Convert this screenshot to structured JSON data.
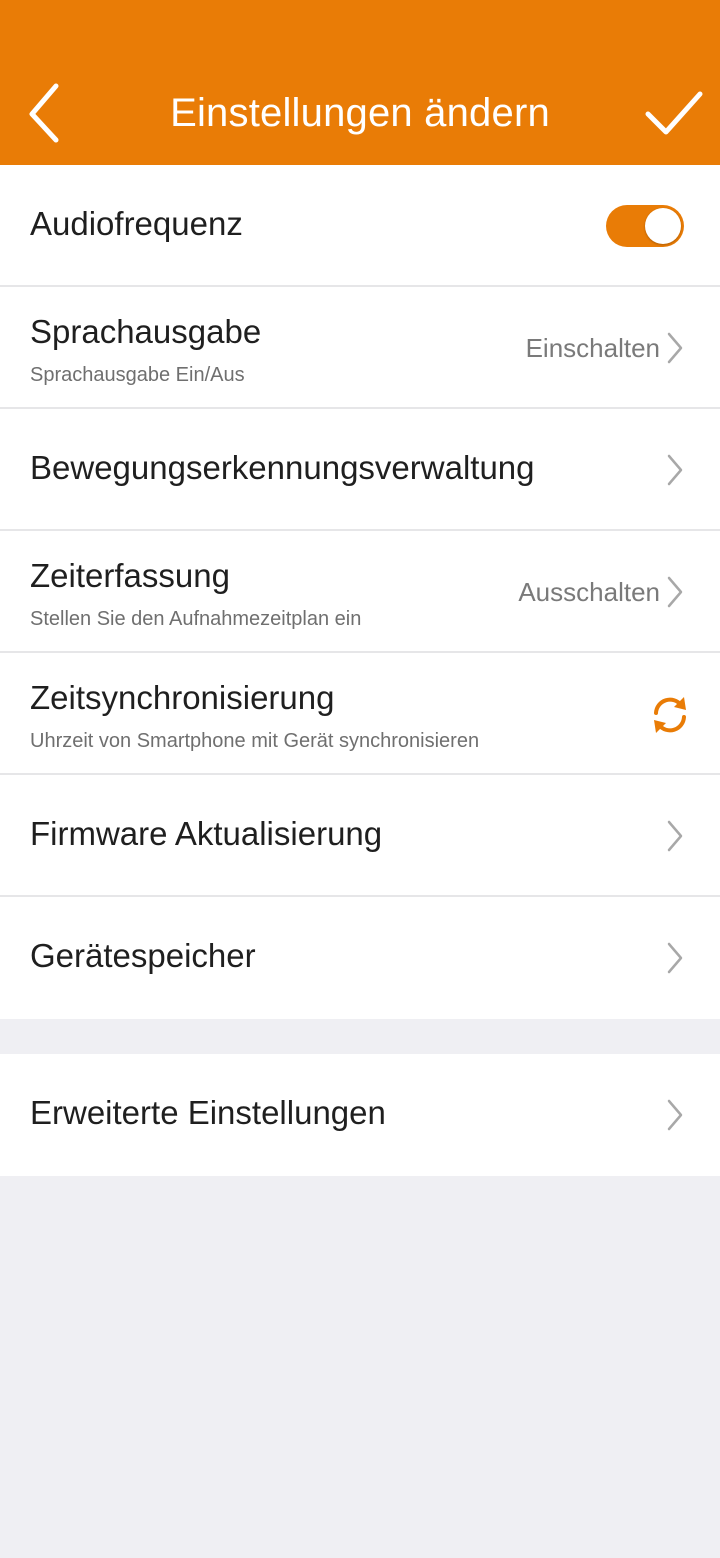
{
  "header": {
    "title": "Einstellungen ändern",
    "back_icon": "chevron-left-icon",
    "confirm_icon": "checkmark-icon"
  },
  "settings": {
    "audio": {
      "label": "Audiofrequenz",
      "enabled": true
    },
    "voice": {
      "label": "Sprachausgabe",
      "sub": "Sprachausgabe Ein/Aus",
      "value": "Einschalten"
    },
    "motion": {
      "label": "Bewegungserkennungsverwaltung"
    },
    "schedule": {
      "label": "Zeiterfassung",
      "sub": "Stellen Sie den Aufnahmezeitplan ein",
      "value": "Ausschalten"
    },
    "timesync": {
      "label": "Zeitsynchronisierung",
      "sub": "Uhrzeit von Smartphone mit Gerät synchronisieren",
      "icon": "sync-icon"
    },
    "firmware": {
      "label": "Firmware Aktualisierung"
    },
    "storage": {
      "label": "Gerätespeicher"
    },
    "advanced": {
      "label": "Erweiterte Einstellungen"
    }
  },
  "colors": {
    "accent": "#e97c06",
    "background": "#efeff3",
    "row": "#ffffff",
    "divider": "#e6e6e8",
    "secondary_text": "#7a7a7a",
    "chevron": "#a8a8a8"
  }
}
